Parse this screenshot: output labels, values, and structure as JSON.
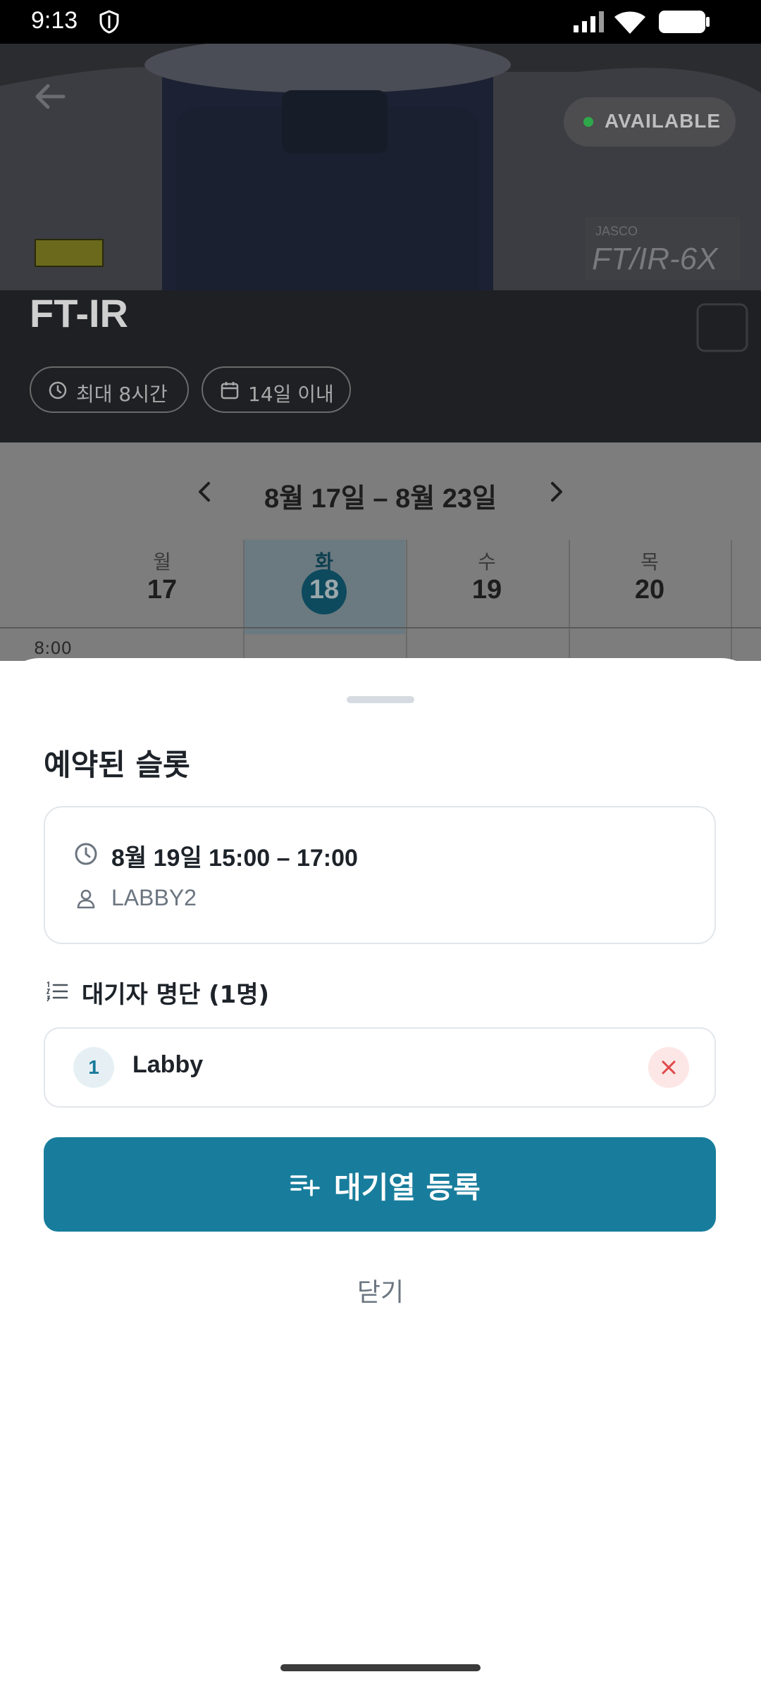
{
  "status_bar": {
    "time": "9:13",
    "icons": [
      "shield-icon",
      "signal-icon",
      "wifi-icon",
      "battery-icon"
    ]
  },
  "hero": {
    "title": "FT-IR",
    "availability": "AVAILABLE",
    "availability_color": "#2ea84a",
    "chips": [
      {
        "icon": "clock-icon",
        "label": "최대 8시간"
      },
      {
        "icon": "calendar-icon",
        "label": "14일 이내"
      }
    ],
    "device_brand": "JASCO",
    "device_model": "FT/IR-6X"
  },
  "calendar": {
    "week_label": "8월 17일 – 8월 23일",
    "days": [
      {
        "name": "월",
        "num": "17",
        "today": false
      },
      {
        "name": "화",
        "num": "18",
        "today": true
      },
      {
        "name": "수",
        "num": "19",
        "today": false
      },
      {
        "name": "목",
        "num": "20",
        "today": false
      }
    ],
    "first_time": "8:00"
  },
  "sheet": {
    "title": "예약된 슬롯",
    "slot": {
      "time": "8월 19일 15:00 – 17:00",
      "user": "LABBY2"
    },
    "waitlist_title": "대기자 명단 (1명)",
    "waitlist": [
      {
        "rank": "1",
        "name": "Labby"
      }
    ],
    "primary_button": "대기열 등록",
    "close_button": "닫기"
  },
  "colors": {
    "accent": "#187d9c",
    "danger": "#e04848"
  }
}
